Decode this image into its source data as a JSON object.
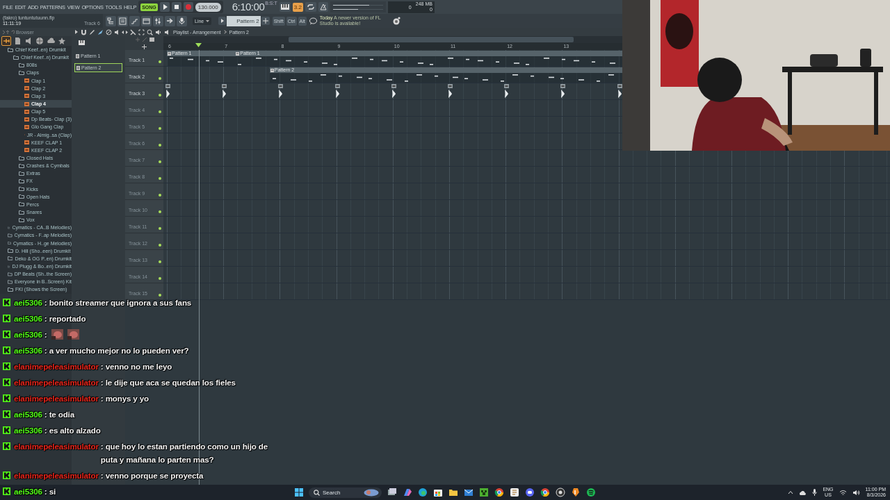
{
  "menu": [
    "FILE",
    "EDIT",
    "ADD",
    "PATTERNS",
    "VIEW",
    "OPTIONS",
    "TOOLS",
    "HELP"
  ],
  "transport": {
    "mode": "SONG",
    "tempo": "130.000",
    "time": "6:10:00",
    "time_unit": "B:S:T",
    "step": "3.2"
  },
  "master": {
    "volume": {
      "level": 0.72
    },
    "pitch": {
      "level": 0.5
    }
  },
  "monitor": {
    "cpu": "0",
    "memory": "248 MB",
    "polyphony": "0"
  },
  "project": {
    "file": "(fakro) tuntuntutuunn.flp",
    "time": "11:11:19",
    "hint": "Track 6"
  },
  "snap": "Line",
  "pattern": "Pattern 2",
  "modifiers": [
    "Shift",
    "Ctrl",
    "Alt"
  ],
  "news": {
    "date": "Today",
    "text": "A newer version of FL Studio is available!"
  },
  "browser": {
    "title": "Browser",
    "items": [
      {
        "name": "Chief Keef..en) Drumkit",
        "kind": "folder",
        "selected": false,
        "children": [
          {
            "name": "Chief Keef..n) Drumkit",
            "kind": "folder",
            "selected": false,
            "children": [
              {
                "name": "808s",
                "kind": "folder",
                "selected": false
              },
              {
                "name": "Claps",
                "kind": "folder",
                "selected": false,
                "children": [
                  {
                    "name": "Clap 1",
                    "kind": "file",
                    "selected": false
                  },
                  {
                    "name": "Clap 2",
                    "kind": "file",
                    "selected": false
                  },
                  {
                    "name": "Clap 3",
                    "kind": "file",
                    "selected": false
                  },
                  {
                    "name": "Clap 4",
                    "kind": "file",
                    "selected": true
                  },
                  {
                    "name": "Clap 5",
                    "kind": "file",
                    "selected": false
                  },
                  {
                    "name": "Dp Beats- Clap (3)",
                    "kind": "file",
                    "selected": false
                  },
                  {
                    "name": "Glo Gang Clap",
                    "kind": "file",
                    "selected": false
                  },
                  {
                    "name": "JR - Almig..sa (Clap)",
                    "kind": "file",
                    "selected": false
                  },
                  {
                    "name": "KEEF CLAP 1",
                    "kind": "file",
                    "selected": false
                  },
                  {
                    "name": "KEEF CLAP 2",
                    "kind": "file",
                    "selected": false
                  }
                ]
              },
              {
                "name": "Closed Hats",
                "kind": "folder",
                "selected": false
              },
              {
                "name": "Crashes & Cymbals",
                "kind": "folder",
                "selected": false
              },
              {
                "name": "Extras",
                "kind": "folder",
                "selected": false
              },
              {
                "name": "FX",
                "kind": "folder",
                "selected": false
              },
              {
                "name": "Kicks",
                "kind": "folder",
                "selected": false
              },
              {
                "name": "Open Hats",
                "kind": "folder",
                "selected": false
              },
              {
                "name": "Percs",
                "kind": "folder",
                "selected": false
              },
              {
                "name": "Snares",
                "kind": "folder",
                "selected": false
              },
              {
                "name": "Vox",
                "kind": "folder",
                "selected": false
              }
            ]
          }
        ]
      },
      {
        "name": "Cymatics - CA..B Melodies)",
        "kind": "folder",
        "selected": false
      },
      {
        "name": "Cymatics - F..ap Melodies)",
        "kind": "folder",
        "selected": false
      },
      {
        "name": "Cymatics - H..ge Melodies)",
        "kind": "folder",
        "selected": false
      },
      {
        "name": "D. Hill (Sho..een) Drumkit",
        "kind": "folder",
        "selected": false
      },
      {
        "name": "Deko & OG P..en) Drumkit",
        "kind": "folder",
        "selected": false
      },
      {
        "name": "DJ Plugg & Bo..en) Drumkit",
        "kind": "folder",
        "selected": false
      },
      {
        "name": "DP Beats (Sh..the Screen)",
        "kind": "folder",
        "selected": false
      },
      {
        "name": "Everyone in B..Screen) Kit",
        "kind": "folder",
        "selected": false
      },
      {
        "name": "FKI (Shows the Screen)",
        "kind": "folder",
        "selected": false
      }
    ]
  },
  "patterns": [
    {
      "name": "Pattern 1",
      "selected": false
    },
    {
      "name": "Pattern 2",
      "selected": true
    }
  ],
  "playlist": {
    "title": "Playlist - Arrangement",
    "breadcrumb": "Pattern 2",
    "bars": [
      "6",
      "7",
      "8",
      "9",
      "10",
      "11",
      "12",
      "13"
    ],
    "tracks": [
      {
        "name": "Track 1",
        "clips": [
          {
            "kind": "pattern",
            "label": "Pattern 1"
          },
          {
            "kind": "pattern",
            "label": "Pattern 1"
          }
        ]
      },
      {
        "name": "Track 2",
        "clips": [
          {
            "kind": "pattern",
            "label": "Pattern 2"
          }
        ]
      },
      {
        "name": "Track 3",
        "clips": [
          {
            "kind": "audio"
          },
          {
            "kind": "audio"
          },
          {
            "kind": "audio"
          },
          {
            "kind": "audio"
          },
          {
            "kind": "audio"
          },
          {
            "kind": "audio"
          },
          {
            "kind": "audio"
          },
          {
            "kind": "audio"
          },
          {
            "kind": "audio"
          }
        ]
      },
      {
        "name": "Track 4"
      },
      {
        "name": "Track 5"
      },
      {
        "name": "Track 6"
      },
      {
        "name": "Track 7"
      },
      {
        "name": "Track 8"
      },
      {
        "name": "Track 9"
      },
      {
        "name": "Track 10"
      },
      {
        "name": "Track 11"
      },
      {
        "name": "Track 12"
      },
      {
        "name": "Track 13"
      },
      {
        "name": "Track 14"
      },
      {
        "name": "Track 15"
      }
    ]
  },
  "chat": [
    {
      "user": "aei5306",
      "color": "#53fc18",
      "message": ": bonito streamer que ignora a sus fans"
    },
    {
      "user": "aei5306",
      "color": "#53fc18",
      "message": ": reportado"
    },
    {
      "user": "aei5306",
      "color": "#53fc18",
      "message": ":"
    },
    {
      "user": "aei5306",
      "color": "#53fc18",
      "message": ": a ver mucho mejor no lo pueden ver?"
    },
    {
      "user": "elanimepeleasimulator",
      "color": "#e8251b",
      "message": ": venno no me leyo"
    },
    {
      "user": "elanimepeleasimulator",
      "color": "#e8251b",
      "message": ": le dije que aca se quedan los fieles"
    },
    {
      "user": "elanimepeleasimulator",
      "color": "#e8251b",
      "message": ": monys y yo"
    },
    {
      "user": "aei5306",
      "color": "#53fc18",
      "message": ": te odia"
    },
    {
      "user": "aei5306",
      "color": "#53fc18",
      "message": ": es alto alzado"
    },
    {
      "user": "elanimepeleasimulator",
      "color": "#e8251b",
      "message": ": que hoy lo estan partiendo como un hijo de puta y mañana lo parten mas?"
    },
    {
      "user": "elanimepeleasimulator",
      "color": "#e8251b",
      "message": ": venno porque se proyecta"
    },
    {
      "user": "aei5306",
      "color": "#53fc18",
      "message": ": si"
    }
  ],
  "taskbar": {
    "search": {
      "placeholder": "Search"
    },
    "language": "ENG",
    "region": "US",
    "time": "11:00 PM",
    "date": "8/3/2026"
  }
}
